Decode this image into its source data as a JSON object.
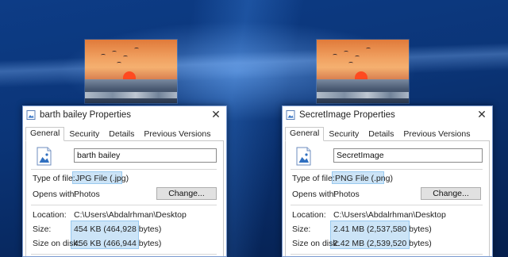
{
  "dialogs": [
    {
      "title": "barth bailey Properties",
      "tabs": [
        "General",
        "Security",
        "Details",
        "Previous Versions"
      ],
      "name_value": "barth bailey",
      "type_label": "Type of file:",
      "type_value": "JPG File (.jpg)",
      "opens_label": "Opens with:",
      "opens_value": "Photos",
      "change_label": "Change...",
      "location_label": "Location:",
      "location_value": "C:\\Users\\Abdalrhman\\Desktop",
      "size_label": "Size:",
      "size_value": "454 KB (464,928 bytes)",
      "disk_label": "Size on disk:",
      "disk_value": "456 KB (466,944 bytes)"
    },
    {
      "title": "SecretImage Properties",
      "tabs": [
        "General",
        "Security",
        "Details",
        "Previous Versions"
      ],
      "name_value": "SecretImage",
      "type_label": "Type of file:",
      "type_value": "PNG File (.png)",
      "opens_label": "Opens with:",
      "opens_value": "Photos",
      "change_label": "Change...",
      "location_label": "Location:",
      "location_value": "C:\\Users\\Abdalrhman\\Desktop",
      "size_label": "Size:",
      "size_value": "2.41 MB (2,537,580 bytes)",
      "disk_label": "Size on disk:",
      "disk_value": "2.42 MB (2,539,520 bytes)"
    }
  ],
  "icons": {
    "title": "image-file-icon",
    "file": "image-file-icon",
    "close": "close-icon"
  },
  "colors": {
    "highlight": "#cce4f7",
    "highlight_border": "#99c9ef",
    "desktop": "#0b3578"
  }
}
